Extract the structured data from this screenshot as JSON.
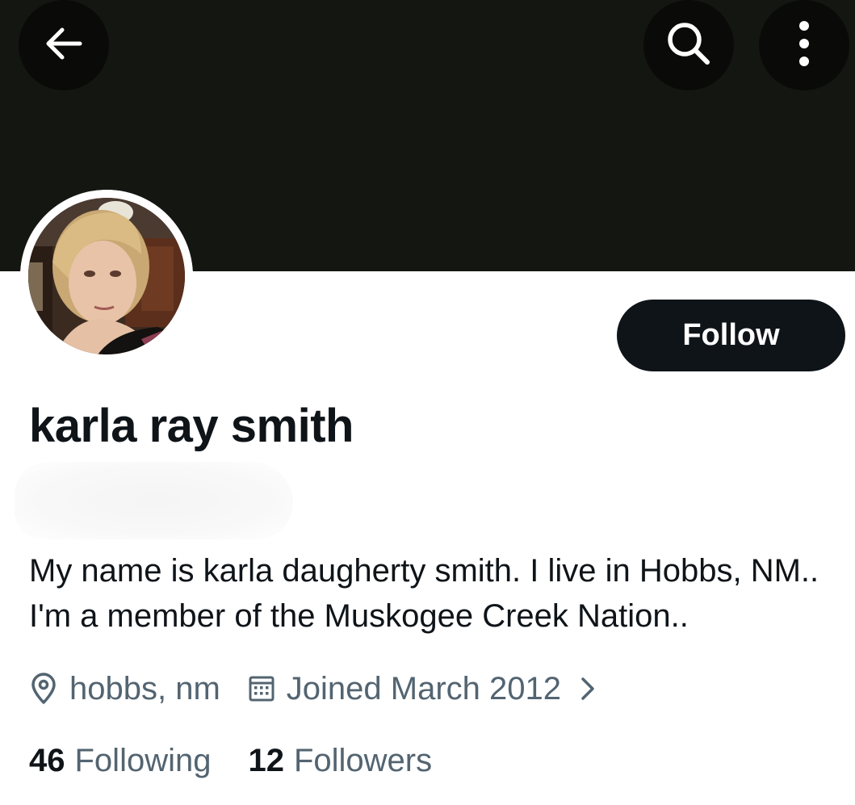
{
  "header": {
    "back_icon": "arrow-left-icon",
    "search_icon": "search-icon",
    "more_icon": "more-vertical-icon",
    "banner_color": "#141711"
  },
  "profile": {
    "display_name": "karla ray smith",
    "follow_label": "Follow",
    "bio": "My name is karla daugherty smith. I live in Hobbs, NM.. I'm a member of the Muskogee Creek Nation..",
    "location": "hobbs, nm",
    "joined": "Joined March 2012",
    "following_count": "46",
    "following_label": "Following",
    "followers_count": "12",
    "followers_label": "Followers"
  },
  "colors": {
    "primary_text": "#0f1419",
    "secondary_text": "#536471",
    "button_bg": "#0f1419"
  }
}
